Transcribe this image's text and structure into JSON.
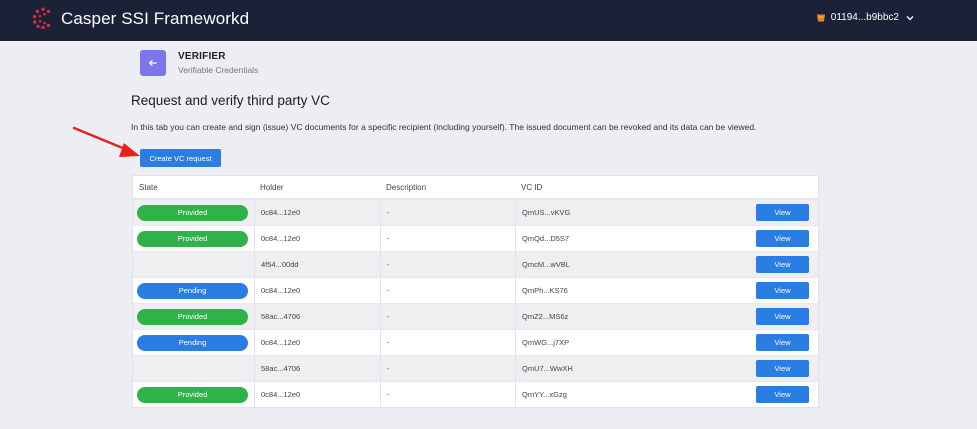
{
  "app": {
    "title": "Casper SSI Frameworkd"
  },
  "account": {
    "address": "01194...b9bbc2",
    "icon": "wallet-icon"
  },
  "header": {
    "role": "VERIFIER",
    "subtitle": "Verifiable Credentials"
  },
  "page": {
    "title": "Request and verify third party VC",
    "description": "In this tab you can create and sign (issue) VC documents for a specific recipient (including yourself). The issued document can be revoked and its data can be viewed.",
    "create_button": "Create VC request"
  },
  "table": {
    "columns": [
      "State",
      "Holder",
      "Description",
      "VC ID"
    ],
    "view_label": "View",
    "rows": [
      {
        "state": "Provided",
        "holder": "0c84...12e0",
        "description": "-",
        "vcid": "QmUS...vKVG"
      },
      {
        "state": "Provided",
        "holder": "0c84...12e0",
        "description": "-",
        "vcid": "QmQd...D5S7"
      },
      {
        "state": "",
        "holder": "4f54...00dd",
        "description": "-",
        "vcid": "QmcM...wVBL"
      },
      {
        "state": "Pending",
        "holder": "0c84...12e0",
        "description": "-",
        "vcid": "QmPh...KS76"
      },
      {
        "state": "Provided",
        "holder": "58ac...4706",
        "description": "-",
        "vcid": "QmZ2...MS6z"
      },
      {
        "state": "Pending",
        "holder": "0c84...12e0",
        "description": "-",
        "vcid": "QmWG...j7XP"
      },
      {
        "state": "",
        "holder": "58ac...4706",
        "description": "-",
        "vcid": "QmU7...WwXH"
      },
      {
        "state": "Provided",
        "holder": "0c84...12e0",
        "description": "-",
        "vcid": "QmYY...xGzg"
      }
    ]
  },
  "colors": {
    "topbar": "#1b2137",
    "accent": "#2a7de3",
    "provided": "#2fb24a",
    "back_button": "#7d75ec",
    "arrow": "#e5231b"
  }
}
